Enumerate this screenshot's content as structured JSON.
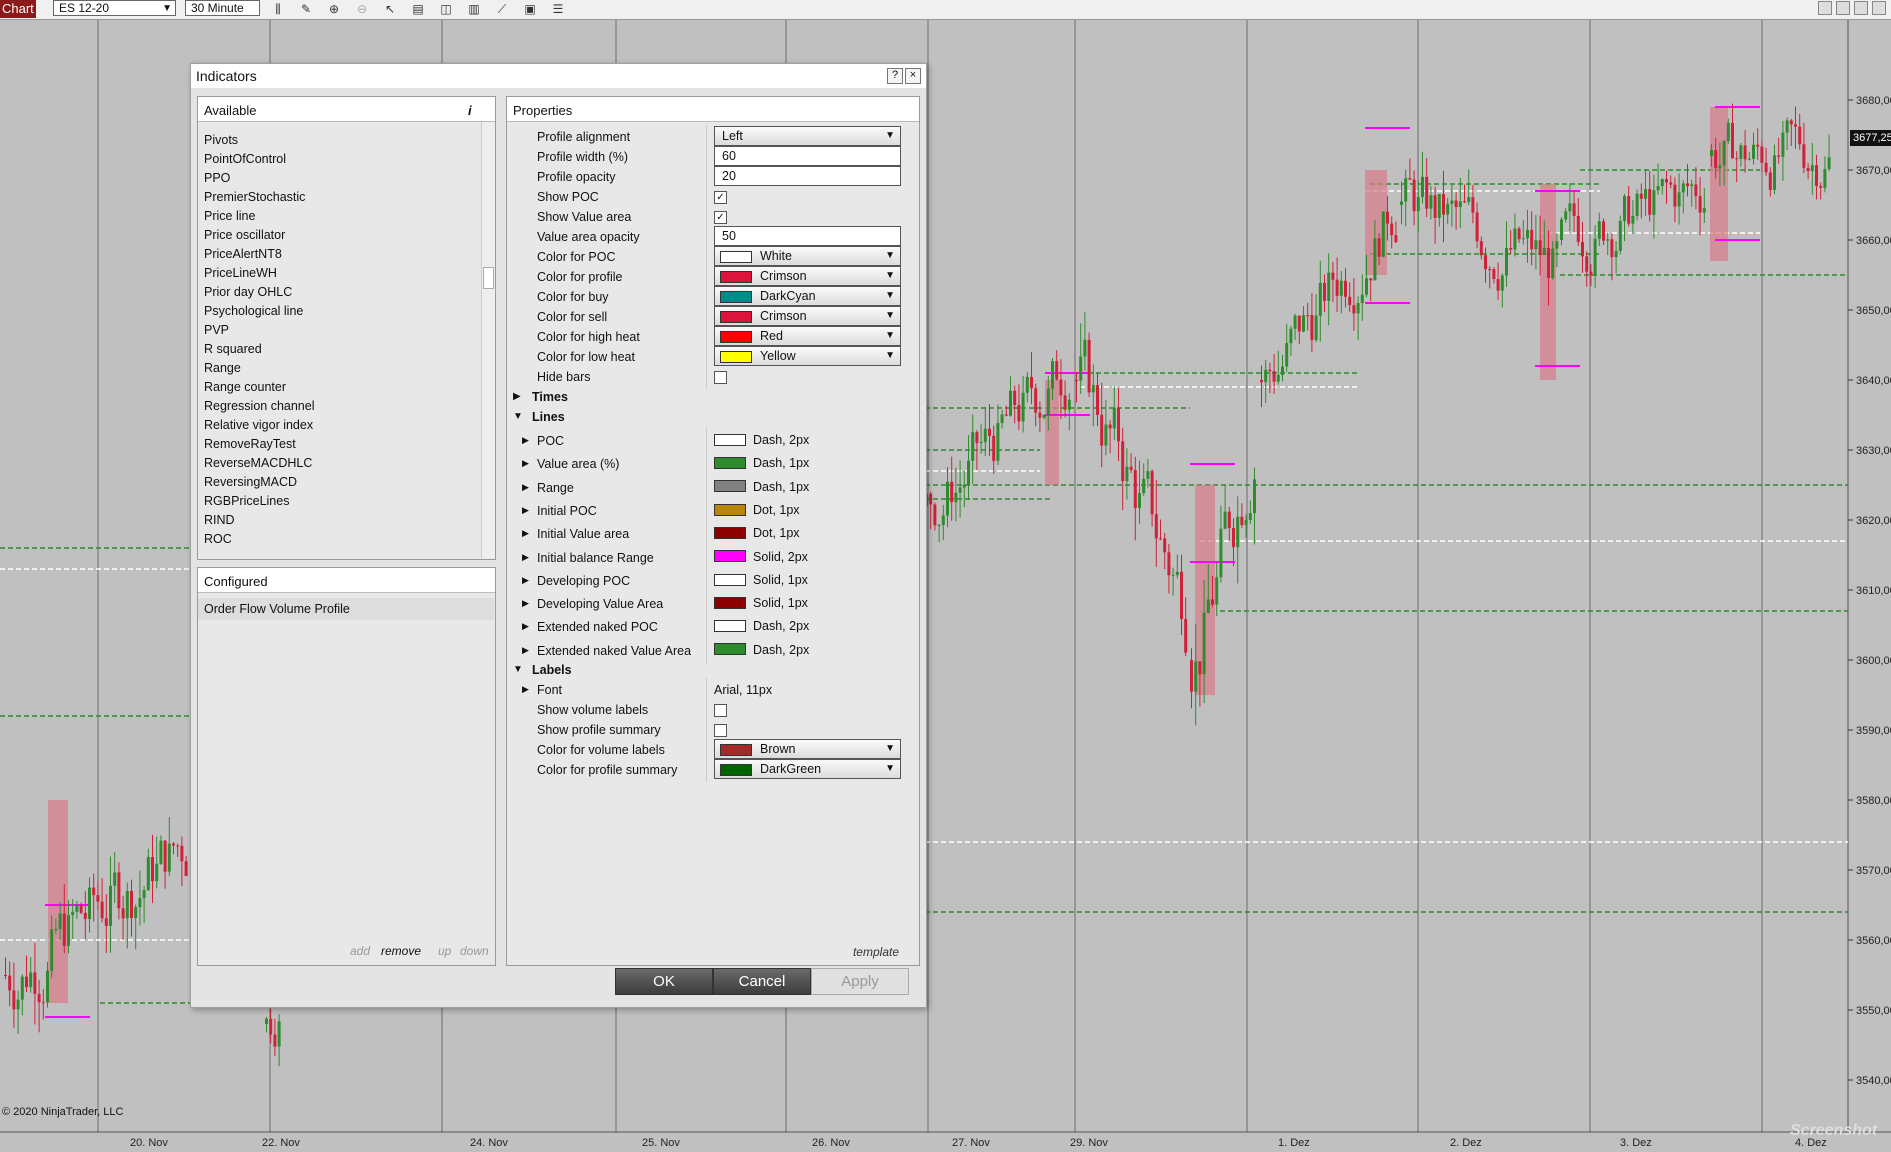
{
  "toolbar": {
    "tab_label": "Chart",
    "instrument": "ES 12-20",
    "interval": "30 Minute"
  },
  "chart": {
    "y_labels": [
      "3680,00",
      "3670,00",
      "3660,00",
      "3650,00",
      "3640,00",
      "3630,00",
      "3620,00",
      "3610,00",
      "3600,00",
      "3590,00",
      "3580,00",
      "3570,00",
      "3560,00",
      "3550,00",
      "3540,00"
    ],
    "x_labels": [
      "20. Nov",
      "22. Nov",
      "24. Nov",
      "25. Nov",
      "26. Nov",
      "27. Nov",
      "29. Nov",
      "1. Dez",
      "2. Dez",
      "3. Dez",
      "4. Dez"
    ],
    "last_price": "3677,25",
    "copyright": "© 2020 NinjaTrader, LLC",
    "watermark": "Screenshot",
    "colors": {
      "up": "#2e8b2e",
      "down": "#d0203a",
      "profile": "#d97b8a",
      "poc": "#ff00ff",
      "va_line": "#2e8b2e",
      "naked_poc": "#ffffff"
    }
  },
  "dialog": {
    "title": "Indicators",
    "help_icon": "?",
    "close_icon": "×",
    "available": {
      "header": "Available",
      "info_icon": "i",
      "items": [
        "Pivots",
        "PointOfControl",
        "PPO",
        "PremierStochastic",
        "Price line",
        "Price oscillator",
        "PriceAlertNT8",
        "PriceLineWH",
        "Prior day OHLC",
        "Psychological line",
        "PVP",
        "R squared",
        "Range",
        "Range counter",
        "Regression channel",
        "Relative vigor index",
        "RemoveRayTest",
        "ReverseMACDHLC",
        "ReversingMACD",
        "RGBPriceLines",
        "RIND",
        "ROC"
      ]
    },
    "configured": {
      "header": "Configured",
      "items": [
        "Order Flow Volume Profile"
      ],
      "actions": {
        "add": "add",
        "remove": "remove",
        "up": "up",
        "down": "down"
      }
    },
    "properties": {
      "header": "Properties",
      "rows": [
        {
          "label": "Profile alignment",
          "type": "select",
          "value": "Left"
        },
        {
          "label": "Profile width (%)",
          "type": "text",
          "value": "60"
        },
        {
          "label": "Profile opacity",
          "type": "text",
          "value": "20"
        },
        {
          "label": "Show POC",
          "type": "check",
          "checked": true
        },
        {
          "label": "Show Value area",
          "type": "check",
          "checked": true
        },
        {
          "label": "Value area opacity",
          "type": "text",
          "value": "50"
        },
        {
          "label": "Color for POC",
          "type": "color",
          "value": "White",
          "color": "#ffffff"
        },
        {
          "label": "Color for profile",
          "type": "color",
          "value": "Crimson",
          "color": "#dc143c"
        },
        {
          "label": "Color for buy",
          "type": "color",
          "value": "DarkCyan",
          "color": "#008b8b"
        },
        {
          "label": "Color for sell",
          "type": "color",
          "value": "Crimson",
          "color": "#dc143c"
        },
        {
          "label": "Color for high heat",
          "type": "color",
          "value": "Red",
          "color": "#ff0000"
        },
        {
          "label": "Color for low heat",
          "type": "color",
          "value": "Yellow",
          "color": "#ffff00"
        },
        {
          "label": "Hide bars",
          "type": "check",
          "checked": false
        }
      ],
      "times_label": "Times",
      "lines_label": "Lines",
      "lines": [
        {
          "label": "POC",
          "value": "Dash, 2px",
          "color": "#ffffff"
        },
        {
          "label": "Value area (%)",
          "value": "Dash, 1px",
          "color": "#2e8b2e"
        },
        {
          "label": "Range",
          "value": "Dash, 1px",
          "color": "#808080"
        },
        {
          "label": "Initial POC",
          "value": "Dot, 1px",
          "color": "#b8860b"
        },
        {
          "label": "Initial Value area",
          "value": "Dot, 1px",
          "color": "#8b0000"
        },
        {
          "label": "Initial balance Range",
          "value": "Solid, 2px",
          "color": "#ff00ff"
        },
        {
          "label": "Developing POC",
          "value": "Solid, 1px",
          "color": "#ffffff"
        },
        {
          "label": "Developing Value Area",
          "value": "Solid, 1px",
          "color": "#8b0000"
        },
        {
          "label": "Extended naked POC",
          "value": "Dash, 2px",
          "color": "#ffffff"
        },
        {
          "label": "Extended naked Value Area",
          "value": "Dash, 2px",
          "color": "#2e8b2e"
        }
      ],
      "labels_label": "Labels",
      "label_rows": [
        {
          "label": "Font",
          "type": "plain",
          "value": "Arial, 11px"
        },
        {
          "label": "Show volume labels",
          "type": "check",
          "checked": false
        },
        {
          "label": "Show profile summary",
          "type": "check",
          "checked": false
        },
        {
          "label": "Color for volume labels",
          "type": "color",
          "value": "Brown",
          "color": "#a52a2a"
        },
        {
          "label": "Color for profile summary",
          "type": "color",
          "value": "DarkGreen",
          "color": "#006400"
        }
      ],
      "template_link": "template"
    },
    "buttons": {
      "ok": "OK",
      "cancel": "Cancel",
      "apply": "Apply"
    }
  }
}
